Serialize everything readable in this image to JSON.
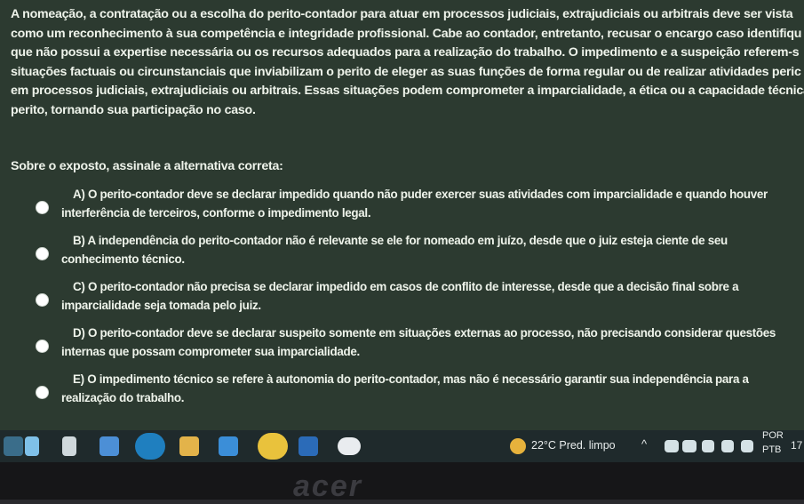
{
  "paragraph_lines": [
    "A nomeação, a contratação ou a escolha do perito-contador para atuar em processos judiciais, extrajudiciais ou arbitrais deve ser vista",
    "como um reconhecimento à sua competência e integridade profissional. Cabe ao contador, entretanto, recusar o encargo caso identifiqu",
    "que não possui a expertise necessária ou os recursos adequados para a realização do trabalho. O impedimento e a suspeição referem-s",
    "situações factuais ou circunstanciais que inviabilizam o perito de eleger as suas funções de forma regular ou de realizar atividades peric",
    "em processos judiciais, extrajudiciais ou arbitrais. Essas situações podem comprometer a imparcialidade, a ética ou a capacidade técnica",
    "perito, tornando sua participação no caso."
  ],
  "question": "Sobre o exposto, assinale a alternativa correta:",
  "options": [
    {
      "letter": "A)",
      "line1": "O perito-contador deve se declarar impedido quando não puder exercer suas atividades com imparcialidade e quando houver",
      "line2": "interferência de terceiros, conforme o impedimento legal."
    },
    {
      "letter": "B)",
      "line1": "A independência do perito-contador não é relevante se ele for nomeado em juízo, desde que o juiz esteja ciente de seu",
      "line2": "conhecimento técnico."
    },
    {
      "letter": "C)",
      "line1": "O perito-contador não precisa se declarar impedido em casos de conflito de interesse, desde que a decisão final sobre a",
      "line2": "imparcialidade seja tomada pelo juiz."
    },
    {
      "letter": "D)",
      "line1": "O perito-contador deve se declarar suspeito somente em situações externas ao processo, não precisando considerar questões",
      "line2": "internas que possam comprometer sua imparcialidade."
    },
    {
      "letter": "E)",
      "line1": "O impedimento técnico se refere à autonomia do perito-contador, mas não é necessário garantir sua independência para a",
      "line2": "realização do trabalho."
    }
  ],
  "taskbar": {
    "weather": "22°C  Pred. limpo",
    "language_top": "POR",
    "language_bottom": "PTB",
    "clock_partial": "17"
  },
  "brand": "acer"
}
